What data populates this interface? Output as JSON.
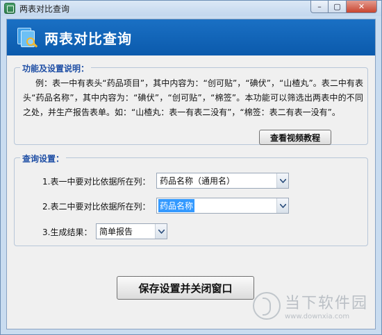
{
  "window": {
    "title": "两表对比查询",
    "min_glyph": "–",
    "max_glyph": "▢",
    "close_glyph": "✕"
  },
  "banner": {
    "title": "两表对比查询"
  },
  "description_group": {
    "legend": "功能及设置说明：",
    "text": "例：表一中有表头“药品项目”，其中内容为：“创可贴”，“碘伏”，“山楂丸”。表二中有表头“药品名称”，其中内容为：“碘伏”，“创可贴”，“棉签”。本功能可以筛选出两表中的不同之处，并生产报告表单。如：“山楂丸：表一有表二没有”，“棉签：表二有表一没有”。",
    "video_button": "查看视频教程"
  },
  "query_group": {
    "legend": "查询设置：",
    "rows": [
      {
        "label": "1.表一中要对比依据所在列：",
        "value": "药品名称（通用名）"
      },
      {
        "label": "2.表二中要对比依据所在列：",
        "value": "药品名称"
      },
      {
        "label": "3.生成结果：",
        "value": "简单报告"
      }
    ]
  },
  "save_button": "保存设置并关闭窗口",
  "watermark": {
    "name": "当下软件园",
    "url": "www.downxia.com"
  },
  "colors": {
    "banner": "#0b5aac",
    "legend": "#1f4fa5",
    "selection": "#3399ff"
  }
}
